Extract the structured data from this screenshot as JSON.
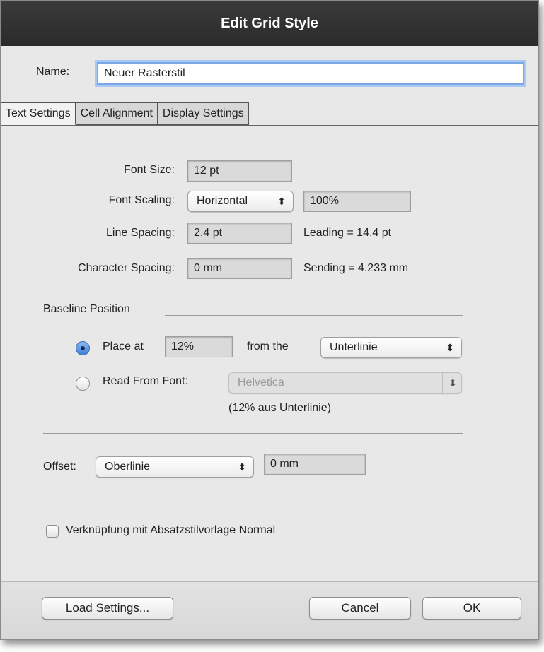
{
  "dialog": {
    "title": "Edit Grid Style",
    "name_label": "Name:",
    "name_value": "Neuer Rasterstil"
  },
  "tabs": [
    {
      "label": "Text Settings",
      "active": true
    },
    {
      "label": "Cell Alignment",
      "active": false
    },
    {
      "label": "Display Settings",
      "active": false
    }
  ],
  "text_settings": {
    "font_size": {
      "label": "Font Size:",
      "value": "12 pt"
    },
    "font_scaling": {
      "label": "Font Scaling:",
      "mode": "Horizontal",
      "value": "100%"
    },
    "line_spacing": {
      "label": "Line Spacing:",
      "value": "2.4 pt",
      "note": "Leading = 14.4 pt"
    },
    "character_spacing": {
      "label": "Character Spacing:",
      "value": "0 mm",
      "note": "Sending = 4.233 mm"
    }
  },
  "baseline": {
    "section_label": "Baseline Position",
    "place_at": {
      "label": "Place at",
      "value": "12%",
      "from_label": "from the",
      "from_value": "Unterlinie",
      "selected": true
    },
    "read_from_font": {
      "label": "Read From Font:",
      "font_value": "Helvetica",
      "note": "(12% aus Unterlinie)",
      "selected": false
    }
  },
  "offset": {
    "label": "Offset:",
    "mode": "Oberlinie",
    "value": "0 mm"
  },
  "link_checkbox": {
    "label": "Verknüpfung mit Absatzstilvorlage Normal",
    "checked": false
  },
  "buttons": {
    "load_settings": "Load Settings...",
    "cancel": "Cancel",
    "ok": "OK"
  },
  "icons": {
    "popup_arrows": "⬍"
  },
  "colors": {
    "title_bar": "#2f2f2f",
    "focus_ring": "#7aa7e6",
    "radio_selected": "#3f7fd8"
  }
}
